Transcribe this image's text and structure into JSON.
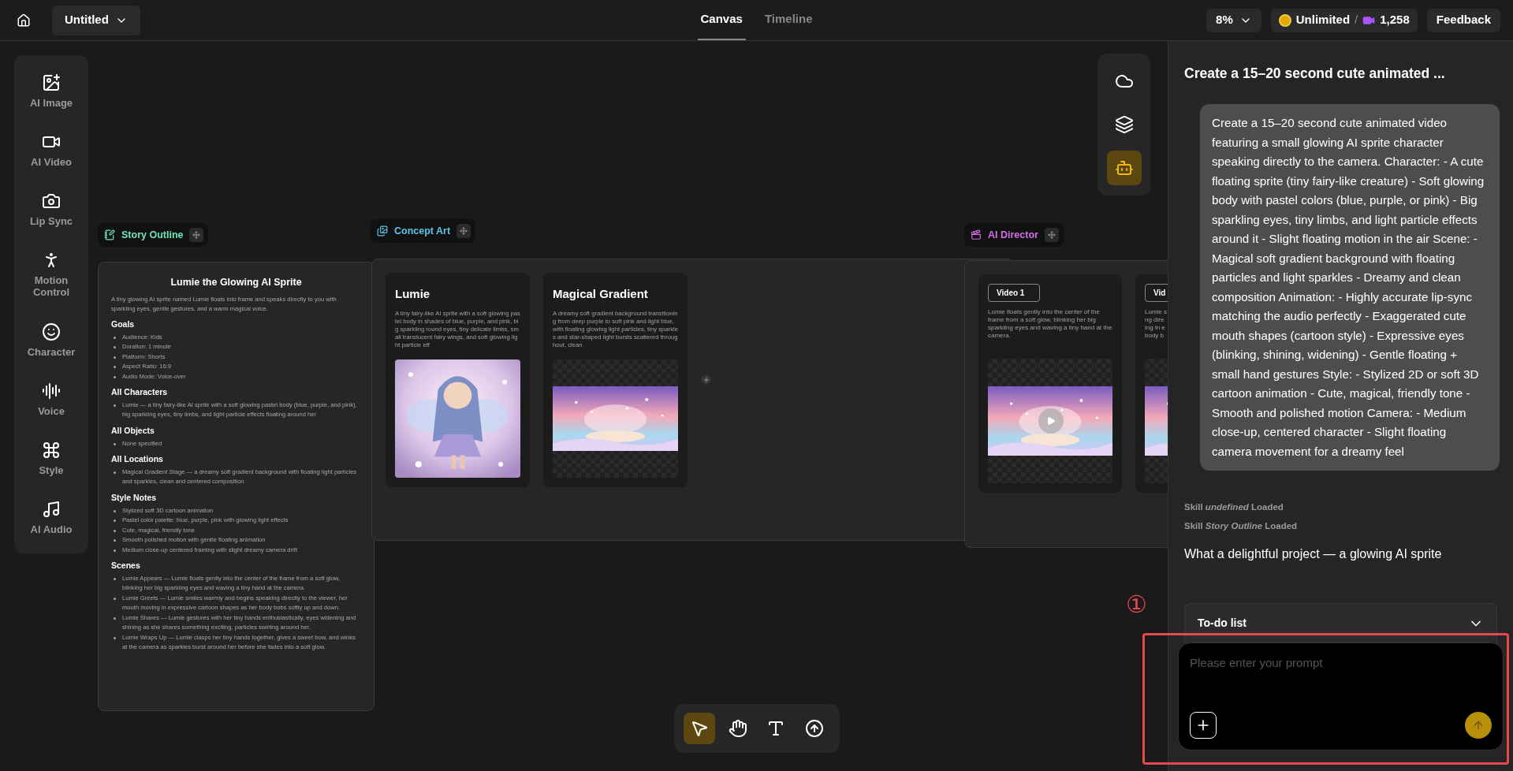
{
  "header": {
    "project": "Untitled",
    "tabs": [
      {
        "label": "Canvas",
        "selected": true
      },
      {
        "label": "Timeline",
        "selected": false
      }
    ],
    "zoom": "8%",
    "credits": "Unlimited",
    "separator": "/",
    "video_credits": "1,258",
    "feedback": "Feedback"
  },
  "sidebar": {
    "items": [
      {
        "label": "AI Image"
      },
      {
        "label": "AI Video"
      },
      {
        "label": "Lip Sync"
      },
      {
        "label": "Motion Control"
      },
      {
        "label": "Character"
      },
      {
        "label": "Voice"
      },
      {
        "label": "Style"
      },
      {
        "label": "AI Audio"
      }
    ]
  },
  "canvas_tools": [
    {
      "kind": "cloud",
      "selected": false
    },
    {
      "kind": "layers",
      "selected": false
    },
    {
      "kind": "robot",
      "selected": true
    }
  ],
  "story_outline": {
    "label": "Story Outline",
    "title": "Lumie the Glowing AI Sprite",
    "summary": "A tiny glowing AI sprite named Lumie floats into frame and speaks directly to you with sparkling eyes, gentle gestures, and a warm magical voice.",
    "sections": [
      {
        "heading": "Goals",
        "items": [
          "Audience: Kids",
          "Duration: 1 minute",
          "Platform: Shorts",
          "Aspect Ratio: 16:9",
          "Audio Mode: Voice-over"
        ]
      },
      {
        "heading": "All Characters",
        "items": [
          "Lumie — a tiny fairy-like AI sprite with a soft glowing pastel body (blue, purple, and pink), big sparkling eyes, tiny limbs, and light particle effects floating around her"
        ]
      },
      {
        "heading": "All Objects",
        "items": [
          "None specified"
        ]
      },
      {
        "heading": "All Locations",
        "items": [
          "Magical Gradient Stage — a dreamy soft gradient background with floating light particles and sparkles, clean and centered composition"
        ]
      },
      {
        "heading": "Style Notes",
        "items": [
          "Stylized soft 3D cartoon animation",
          "Pastel color palette: blue, purple, pink with glowing light effects",
          "Cute, magical, friendly tone",
          "Smooth polished motion with gentle floating animation",
          "Medium close-up centered framing with slight dreamy camera drift"
        ]
      },
      {
        "heading": "Scenes",
        "items": [
          "Lumie Appears — Lumie floats gently into the center of the frame from a soft glow, blinking her big sparkling eyes and waving a tiny hand at the camera.",
          "Lumie Greets — Lumie smiles warmly and begins speaking directly to the viewer, her mouth moving in expressive cartoon shapes as her body bobs softly up and down.",
          "Lumie Shares — Lumie gestures with her tiny hands enthusiastically, eyes widening and shining as she shares something exciting, particles swirling around her.",
          "Lumie Wraps Up — Lumie clasps her tiny hands together, gives a sweet bow, and winks at the camera as sparkles burst around her before she fades into a soft glow."
        ]
      }
    ]
  },
  "concept_art": {
    "label": "Concept Art",
    "cards": [
      {
        "kind": "character",
        "title": "Lumie",
        "description": "A tiny fairy-like AI sprite with a soft glowing pastel body in shades of blue, purple, and pink, big sparkling round eyes, tiny delicate limbs, small translucent fairy wings, and soft glowing light particle eff"
      },
      {
        "kind": "location",
        "title": "Magical Gradient",
        "description": "A dreamy soft gradient background transitioning from deep purple to soft pink and light blue, with floating glowing light particles, tiny sparkles and star-shaped light bursts scattered throughout, clean"
      }
    ]
  },
  "ai_director": {
    "label": "AI Director",
    "videos": [
      {
        "button": "Video 1",
        "play": true,
        "lines": [
          "Lumie floats gently into the center of the frame from a soft glow, blinking her big sparkling eyes and waving a tiny hand at the camera."
        ]
      },
      {
        "button": "Vid",
        "lines": [
          "Lumie s",
          "ng dire",
          "ing in e",
          "body b"
        ]
      }
    ]
  },
  "chat": {
    "title": "Create a 15–20 second cute animated ...",
    "prompt": "Create a 15–20 second cute animated video featuring a small glowing AI sprite character speaking directly to the camera. Character: - A cute floating sprite (tiny fairy-like creature) - Soft glowing body with pastel colors (blue, purple, or pink) - Big sparkling eyes, tiny limbs, and light particle effects around it - Slight floating motion in the air Scene: - Magical soft gradient background with floating particles and light sparkles - Dreamy and clean composition Animation: - Highly accurate lip-sync matching the audio perfectly - Exaggerated cute mouth shapes (cartoon style) - Expressive eyes (blinking, shining, widening) - Gentle floating + small hand gestures Style: - Stylized 2D or soft 3D cartoon animation - Cute, magical, friendly tone - Smooth and polished motion Camera: - Medium close-up, centered character - Slight floating camera movement for a dreamy feel",
    "skills": [
      "Skill *undefined* Loaded",
      "Skill *Story Outline* Loaded"
    ],
    "reply": "What a delightful project — a glowing AI sprite",
    "todo": "To-do list",
    "input": {
      "placeholder": "Please enter your prompt"
    }
  },
  "annotation": {
    "marker": "①"
  }
}
